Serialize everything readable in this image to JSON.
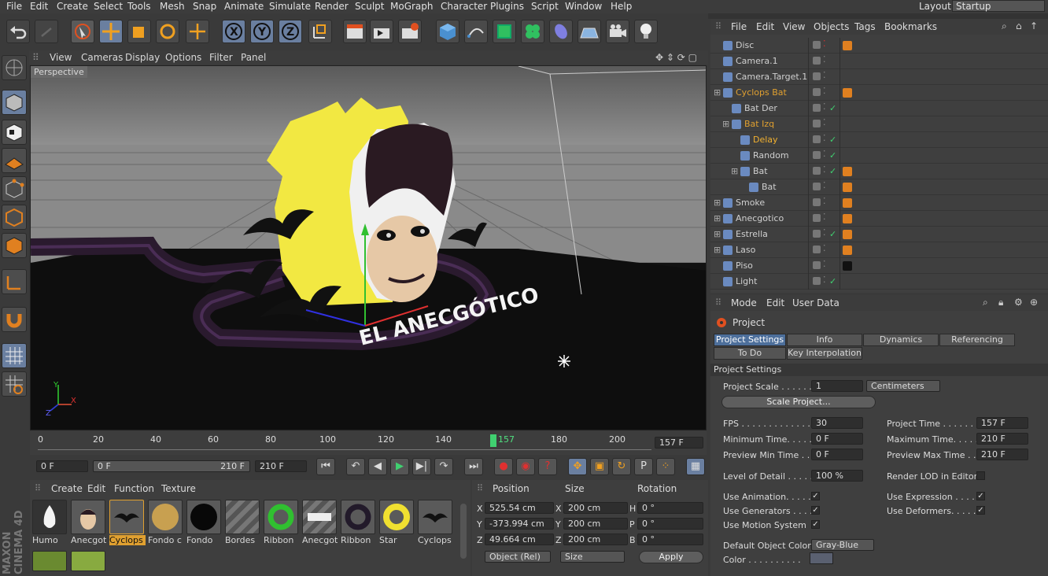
{
  "menu": [
    "File",
    "Edit",
    "Create",
    "Select",
    "Tools",
    "Mesh",
    "Snap",
    "Animate",
    "Simulate",
    "Render",
    "Sculpt",
    "MoGraph",
    "Character",
    "Plugins",
    "Script",
    "Window",
    "Help"
  ],
  "layout": {
    "label": "Layout:",
    "value": "Startup"
  },
  "viewport": {
    "menu": [
      "View",
      "Cameras",
      "Display",
      "Options",
      "Filter",
      "Panel"
    ],
    "camera_label": "Perspective",
    "scene_text": "EL ANECGÓTICO",
    "axis_x": "X",
    "axis_y": "Y",
    "axis_z": "Z"
  },
  "timeline": {
    "ticks": [
      "0",
      "20",
      "40",
      "60",
      "80",
      "100",
      "120",
      "140",
      "157",
      "180",
      "200"
    ],
    "current": "157 F"
  },
  "transport": {
    "start": "0 F",
    "range_start": "0 F",
    "range_end": "210 F",
    "end": "210 F"
  },
  "materials": {
    "menu": [
      "Create",
      "Edit",
      "Function",
      "Texture"
    ],
    "items": [
      "Humo",
      "Anecgot",
      "Cyclops",
      "Fondo c",
      "Fondo",
      "Bordes",
      "Ribbon",
      "Anecgot",
      "Ribbon",
      "Star",
      "Cyclops"
    ],
    "selected": 2,
    "logo_line1": "MAXON",
    "logo_line2": "CINEMA 4D"
  },
  "coords": {
    "headers": [
      "Position",
      "Size",
      "Rotation"
    ],
    "pos": {
      "x": "525.54 cm",
      "y": "-373.994 cm",
      "z": "49.664 cm"
    },
    "size": {
      "x": "200 cm",
      "y": "200 cm",
      "z": "200 cm"
    },
    "rot": {
      "h": "0 °",
      "p": "0 °",
      "b": "0 °"
    },
    "labels": {
      "x": "X",
      "y": "Y",
      "z": "Z",
      "h": "H",
      "p": "P",
      "b": "B"
    },
    "mode": "Object (Rel)",
    "size_mode": "Size",
    "apply": "Apply"
  },
  "objects": {
    "menu": [
      "File",
      "Edit",
      "View",
      "Objects",
      "Tags",
      "Bookmarks"
    ],
    "rows": [
      {
        "name": "Disc",
        "color": "#d0d0d0"
      },
      {
        "name": "Camera.1",
        "color": "#d0d0d0"
      },
      {
        "name": "Camera.Target.1",
        "color": "#d0d0d0"
      },
      {
        "name": "Cyclops Bat",
        "color": "#e0a030"
      },
      {
        "name": "Bat Der",
        "color": "#d0d0d0"
      },
      {
        "name": "Bat Izq",
        "color": "#e0a030"
      },
      {
        "name": "Delay",
        "color": "#f0b030"
      },
      {
        "name": "Random",
        "color": "#d0d0d0"
      },
      {
        "name": "Bat",
        "color": "#d0d0d0"
      },
      {
        "name": "Bat",
        "color": "#d0d0d0"
      },
      {
        "name": "Smoke",
        "color": "#d0d0d0"
      },
      {
        "name": "Anecgotico",
        "color": "#d0d0d0"
      },
      {
        "name": "Estrella",
        "color": "#d0d0d0"
      },
      {
        "name": "Laso",
        "color": "#d0d0d0"
      },
      {
        "name": "Piso",
        "color": "#d0d0d0"
      },
      {
        "name": "Light",
        "color": "#d0d0d0"
      }
    ]
  },
  "attributes": {
    "menu": [
      "Mode",
      "Edit",
      "User Data"
    ],
    "title": "Project",
    "tabs": [
      "Project Settings",
      "Info",
      "Dynamics",
      "Referencing",
      "To Do",
      "Key Interpolation"
    ],
    "section": "Project Settings",
    "project_scale_label": "Project Scale . . . . . .",
    "project_scale": "1",
    "units": "Centimeters",
    "scale_btn": "Scale Project...",
    "fps_label": "FPS . . . . . . . . . . . . . .",
    "fps": "30",
    "min_time_label": "Minimum Time. . . . .",
    "min_time": "0 F",
    "prev_min_label": "Preview Min Time . .",
    "prev_min": "0 F",
    "proj_time_label": "Project Time . . . . . . . .",
    "proj_time": "157 F",
    "max_time_label": "Maximum Time. . . . . .",
    "max_time": "210 F",
    "prev_max_label": "Preview Max Time . . .",
    "prev_max": "210 F",
    "lod_label": "Level of Detail . . . . .",
    "lod": "100 %",
    "render_lod": "Render LOD in Editor",
    "use_anim": "Use Animation. . . . .",
    "use_gen": "Use Generators . . . .",
    "use_motion": "Use Motion System",
    "use_expr": "Use Expression . . . . .",
    "use_def": "Use Deformers. . . . . .",
    "default_color_label": "Default Object Color",
    "default_color": "Gray-Blue",
    "color_label": "Color . . . . . . . . . ."
  }
}
